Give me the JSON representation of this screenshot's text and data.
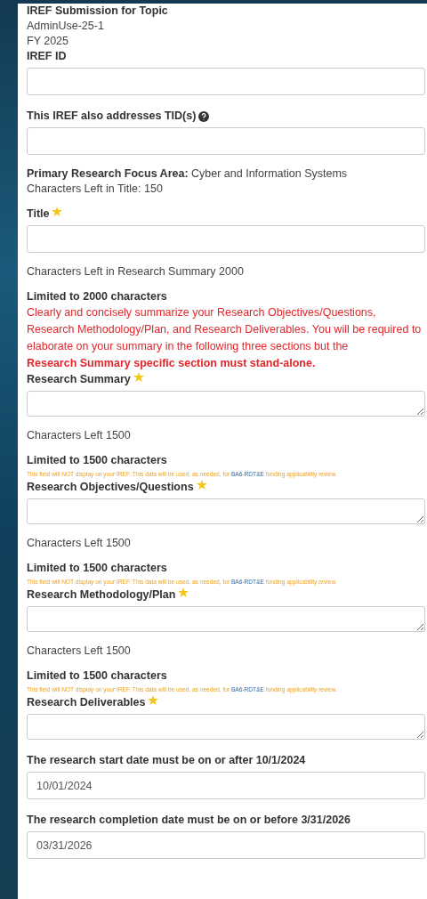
{
  "items": [
    {
      "kind": "heading",
      "text": "IREF Submission for Topic"
    },
    {
      "kind": "text",
      "text": "AdminUse-25-1"
    },
    {
      "kind": "text",
      "text": "FY 2025"
    },
    {
      "kind": "input",
      "label": "IREF ID"
    },
    {
      "kind": "input",
      "label": "This IREF also addresses TID(s)",
      "help": true
    },
    {
      "kind": "labeled",
      "label": "Primary Research Focus Area:",
      "value": "Cyber and Information Systems"
    },
    {
      "kind": "text",
      "text": "Characters Left in Title: 150"
    },
    {
      "kind": "input",
      "label": "Title",
      "required": true
    },
    {
      "kind": "text",
      "text": "Characters Left in Research Summary 2000"
    },
    {
      "kind": "heading",
      "text": "Limited to 2000 characters"
    },
    {
      "kind": "warning",
      "text": "Clearly and concisely summarize your Research Objectives/Questions, Research Methodology/Plan, and Research Deliverables. You will be required to elaborate on your summary in the following three sections but the",
      "emphasis": "Research Summary specific section must stand-alone."
    },
    {
      "kind": "textarea",
      "label": "Research Summary",
      "required": true
    },
    {
      "kind": "text",
      "text": "Characters Left 1500"
    },
    {
      "kind": "heading",
      "text": "Limited to 1500 characters"
    },
    {
      "kind": "disclaimer",
      "text": "This field will NOT display on your IREF. This data will be used, as needed, for",
      "link": "BA6-RDT&E",
      "after": "funding applicability review."
    },
    {
      "kind": "textarea",
      "label": "Research Objectives/Questions",
      "required": true
    },
    {
      "kind": "text",
      "text": "Characters Left 1500"
    },
    {
      "kind": "heading",
      "text": "Limited to 1500 characters"
    },
    {
      "kind": "disclaimer",
      "text": "This field will NOT display on your IREF. This data will be used, as needed, for",
      "link": "BA6-RDT&E",
      "after": "funding applicability review."
    },
    {
      "kind": "textarea",
      "label": "Research Methodology/Plan",
      "required": true
    },
    {
      "kind": "text",
      "text": "Characters Left 1500"
    },
    {
      "kind": "heading",
      "text": "Limited to 1500 characters"
    },
    {
      "kind": "disclaimer",
      "text": "This field will NOT display on your IREF. This data will be used, as needed, for",
      "link": "BA6-RDT&E",
      "after": "funding applicability review."
    },
    {
      "kind": "textarea",
      "label": "Research Deliverables",
      "required": true
    },
    {
      "kind": "input",
      "label": "The research start date must be on or after 10/1/2024",
      "value": "10/01/2024"
    },
    {
      "kind": "input",
      "label": "The research completion date must be on or before 3/31/2026",
      "value": "03/31/2026"
    }
  ]
}
